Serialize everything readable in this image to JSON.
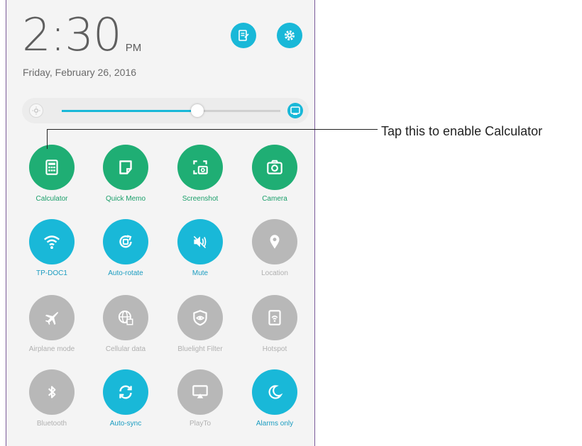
{
  "status": {
    "time": "2:30",
    "ampm": "PM",
    "date": "Friday, February 26, 2016"
  },
  "colors": {
    "active": "#19b8d8",
    "green": "#1fae74",
    "inactive": "#b8b8b8"
  },
  "brightness": {
    "level": 0.62
  },
  "tiles": [
    {
      "label": "Calculator",
      "icon": "calculator-icon",
      "state": "green"
    },
    {
      "label": "Quick Memo",
      "icon": "quick-memo-icon",
      "state": "green"
    },
    {
      "label": "Screenshot",
      "icon": "screenshot-icon",
      "state": "green"
    },
    {
      "label": "Camera",
      "icon": "camera-icon",
      "state": "green"
    },
    {
      "label": "TP-DOC1",
      "icon": "wifi-icon",
      "state": "active"
    },
    {
      "label": "Auto-rotate",
      "icon": "auto-rotate-icon",
      "state": "active"
    },
    {
      "label": "Mute",
      "icon": "mute-icon",
      "state": "active"
    },
    {
      "label": "Location",
      "icon": "location-icon",
      "state": "inactive"
    },
    {
      "label": "Airplane mode",
      "icon": "airplane-icon",
      "state": "inactive"
    },
    {
      "label": "Cellular data",
      "icon": "cellular-data-icon",
      "state": "inactive"
    },
    {
      "label": "Bluelight Filter",
      "icon": "bluelight-filter-icon",
      "state": "inactive"
    },
    {
      "label": "Hotspot",
      "icon": "hotspot-icon",
      "state": "inactive"
    },
    {
      "label": "Bluetooth",
      "icon": "bluetooth-icon",
      "state": "inactive"
    },
    {
      "label": "Auto-sync",
      "icon": "auto-sync-icon",
      "state": "active"
    },
    {
      "label": "PlayTo",
      "icon": "playto-icon",
      "state": "inactive"
    },
    {
      "label": "Alarms only",
      "icon": "alarms-only-icon",
      "state": "active"
    }
  ],
  "annotation": {
    "text": "Tap this to enable Calculator"
  }
}
